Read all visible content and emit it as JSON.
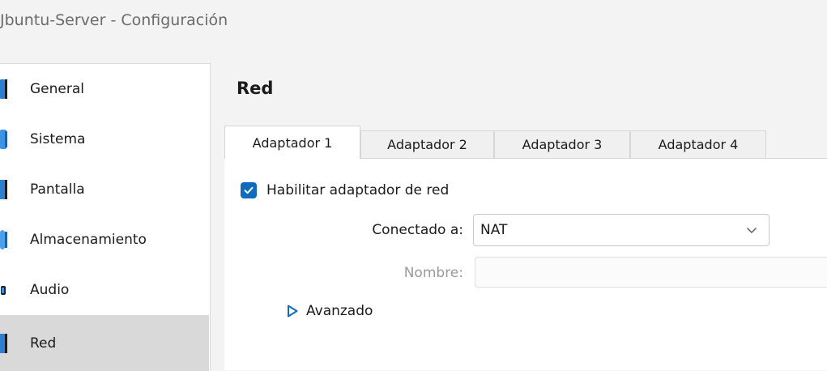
{
  "window": {
    "title": "Jbuntu-Server - Configuración"
  },
  "sidebar": {
    "items": [
      {
        "label": "General",
        "icon": "general-icon",
        "selected": false
      },
      {
        "label": "Sistema",
        "icon": "system-icon",
        "selected": false
      },
      {
        "label": "Pantalla",
        "icon": "display-icon",
        "selected": false
      },
      {
        "label": "Almacenamiento",
        "icon": "storage-icon",
        "selected": false
      },
      {
        "label": "Audio",
        "icon": "audio-icon",
        "selected": false
      },
      {
        "label": "Red",
        "icon": "network-icon",
        "selected": true
      }
    ]
  },
  "main": {
    "heading": "Red",
    "tabs": [
      {
        "label": "Adaptador 1",
        "active": true
      },
      {
        "label": "Adaptador 2",
        "active": false
      },
      {
        "label": "Adaptador 3",
        "active": false
      },
      {
        "label": "Adaptador 4",
        "active": false
      }
    ],
    "enable_adapter": {
      "label": "Habilitar adaptador de red",
      "checked": true
    },
    "connected_to": {
      "label": "Conectado a:",
      "value": "NAT"
    },
    "name": {
      "label": "Nombre:",
      "value": ""
    },
    "advanced": {
      "label": "Avanzado"
    }
  },
  "colors": {
    "accent": "#0f6cbd",
    "selected_bg": "#d9d9d9",
    "disabled_text": "#9a9a9a"
  }
}
